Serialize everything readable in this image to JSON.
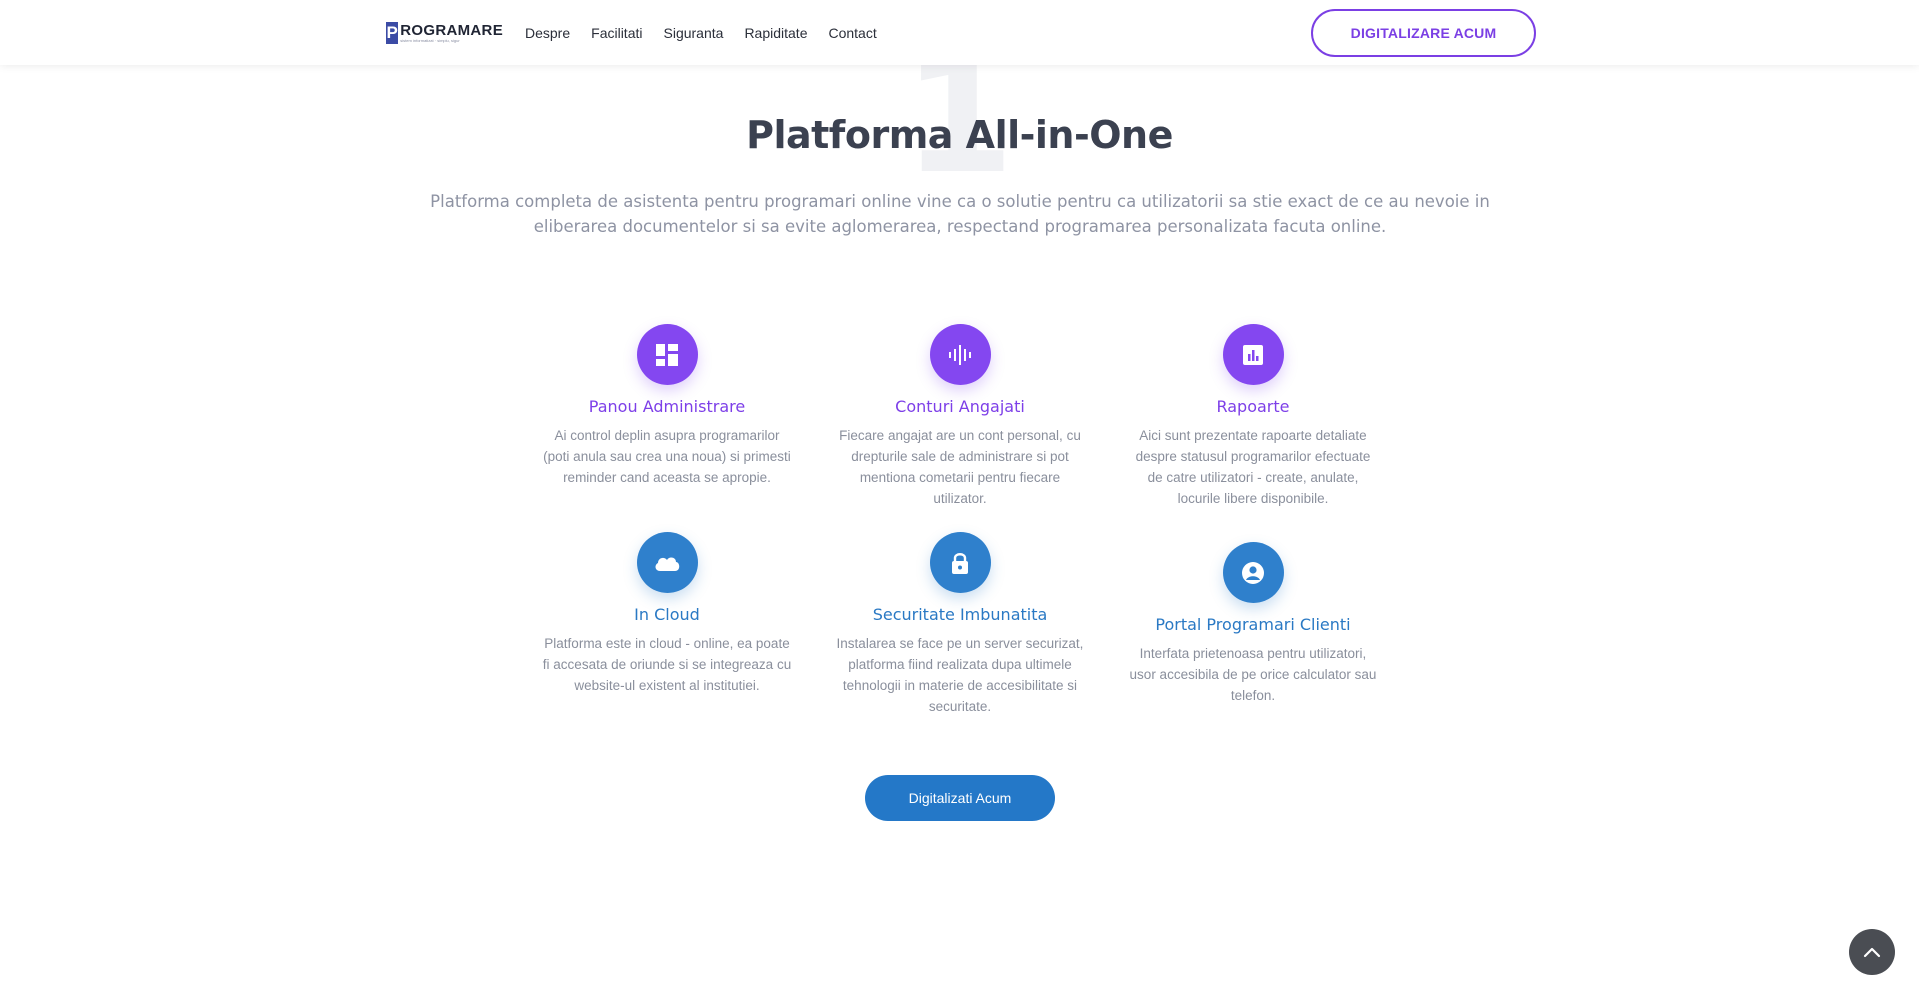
{
  "header": {
    "logo": {
      "mark": "P",
      "word": "ROGRAMARE",
      "tagline": "sistem informatizat · simplu, sigur"
    },
    "nav": [
      "Despre",
      "Facilitati",
      "Siguranta",
      "Rapiditate",
      "Contact"
    ],
    "cta_label": "DIGITALIZARE ACUM"
  },
  "section": {
    "number": "1",
    "title": "Platforma All-in-One",
    "description": "Platforma completa de asistenta pentru programari online vine ca o solutie pentru ca utilizatorii sa stie exact de ce au nevoie in eliberarea documentelor si sa evite aglomerarea, respectand programarea personalizata facuta online."
  },
  "features": [
    {
      "icon": "dashboard-icon",
      "color": "#8447f0",
      "title": "Panou Administrare",
      "text": "Ai control deplin asupra programarilor (poti anula sau crea una noua) si primesti reminder cand aceasta se apropie."
    },
    {
      "icon": "voice-wave-icon",
      "color": "#8447f0",
      "title": "Conturi Angajati",
      "text": "Fiecare angajat are un cont personal, cu drepturile sale de administrare si pot mentiona cometarii pentru fiecare utilizator."
    },
    {
      "icon": "report-chart-icon",
      "color": "#8447f0",
      "title": "Rapoarte",
      "text": "Aici sunt prezentate rapoarte detaliate despre statusul programarilor efectuate de catre utilizatori - create, anulate, locurile libere disponibile."
    },
    {
      "icon": "cloud-icon",
      "color": "#2f80cc",
      "title": "In Cloud",
      "text": "Platforma este in cloud - online, ea poate fi accesata de oriunde si se integreaza cu website-ul existent al institutiei."
    },
    {
      "icon": "lock-icon",
      "color": "#2f80cc",
      "title": "Securitate Imbunatita",
      "text": "Instalarea se face pe un server securizat, platforma fiind realizata dupa ultimele tehnologii in materie de accesibilitate si securitate."
    },
    {
      "icon": "user-circle-icon",
      "color": "#2f80cc",
      "title": "Portal Programari Clienti",
      "text": "Interfata prietenoasa pentru utilizatori, usor accesibila de pe orice calculator sau telefon."
    }
  ],
  "cta_solid_label": "Digitalizati Acum",
  "scroll_top_icon": "chevron-up-icon"
}
